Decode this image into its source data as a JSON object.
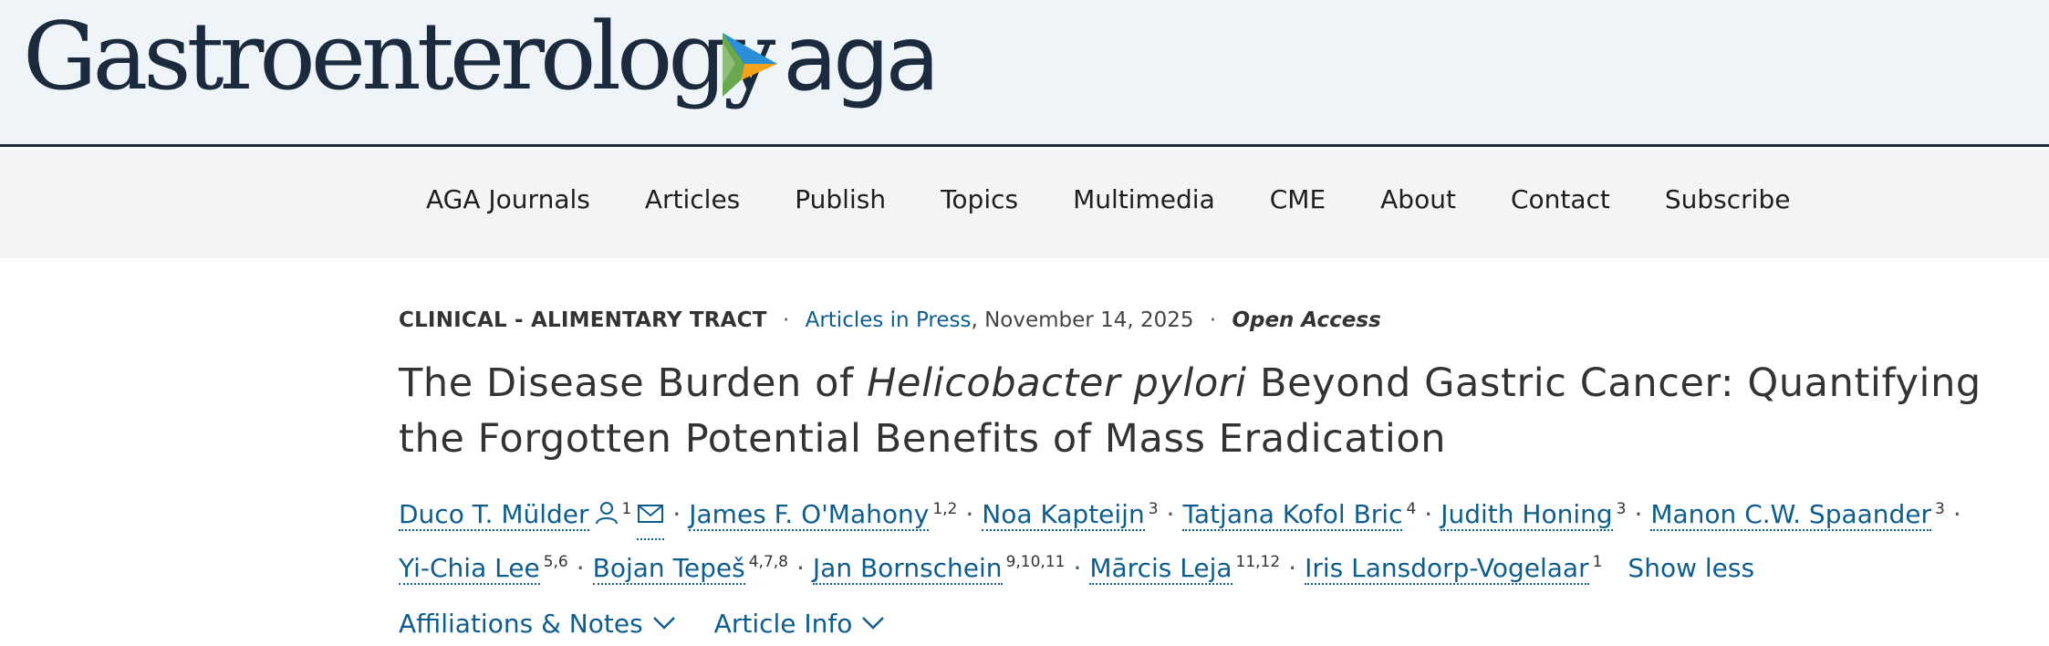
{
  "header": {
    "journal_title": "Gastroenterology",
    "publisher_logo": "aga",
    "logo_colors": {
      "blue": "#2a8fd6",
      "orange": "#f5a21b",
      "green": "#6aa84f",
      "navy": "#1b2a3d"
    }
  },
  "nav": {
    "items": [
      "AGA Journals",
      "Articles",
      "Publish",
      "Topics",
      "Multimedia",
      "CME",
      "About",
      "Contact",
      "Subscribe"
    ]
  },
  "article": {
    "category": "CLINICAL - ALIMENTARY TRACT",
    "section_link": "Articles in Press",
    "date": ", November 14, 2025",
    "access": "Open Access",
    "title_part1": "The Disease Burden of ",
    "title_italic": "Helicobacter pylori",
    "title_part2": " Beyond Gastric Cancer: Quantifying the Forgotten Potential Benefits of Mass Eradication",
    "authors": [
      {
        "name": "Duco T. Mülder",
        "aff": "1"
      },
      {
        "name": "James F. O'Mahony",
        "aff": "1,2"
      },
      {
        "name": "Noa Kapteijn",
        "aff": "3"
      },
      {
        "name": "Tatjana Kofol Bric",
        "aff": "4"
      },
      {
        "name": "Judith Honing",
        "aff": "3"
      },
      {
        "name": "Manon C.W. Spaander",
        "aff": "3"
      },
      {
        "name": "Yi-Chia Lee",
        "aff": "5,6"
      },
      {
        "name": "Bojan Tepeš",
        "aff": "4,7,8"
      },
      {
        "name": "Jan Bornschein",
        "aff": "9,10,11"
      },
      {
        "name": "Mārcis Leja",
        "aff": "11,12"
      },
      {
        "name": "Iris Lansdorp-Vogelaar",
        "aff": "1"
      }
    ],
    "show_less": "Show less",
    "tabs": [
      "Affiliations & Notes",
      "Article Info"
    ]
  }
}
